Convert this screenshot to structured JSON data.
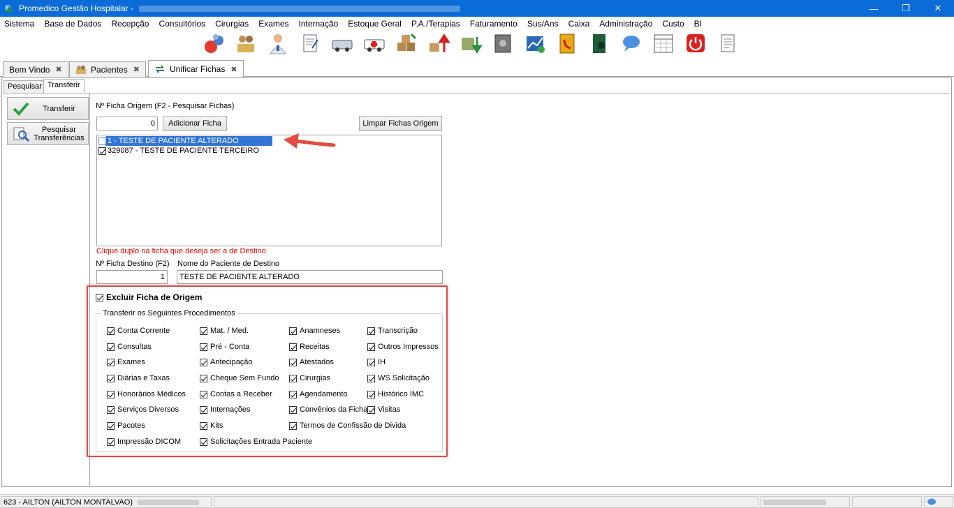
{
  "window": {
    "title": "Promedico Gestão Hospitalar - ",
    "controls": {
      "minimize": "—",
      "maximize": "❐",
      "close": "✕"
    }
  },
  "menu": [
    "Sistema",
    "Base de Dados",
    "Recepção",
    "Consultórios",
    "Cirurgias",
    "Exames",
    "Internação",
    "Estoque Geral",
    "P.A./Terapias",
    "Faturamento",
    "Sus/Ans",
    "Caixa",
    "Administração",
    "Custo",
    "BI"
  ],
  "toolbar_icons": [
    "users-refresh-icon",
    "reception-icon",
    "doctor-icon",
    "prescription-icon",
    "ambulance-icon",
    "emergency-icon",
    "stock-boxes-icon",
    "stock-up-icon",
    "money-icon",
    "safe-icon",
    "billing-chart-icon",
    "phone-book-icon",
    "book-icon",
    "chat-icon",
    "calendar-icon",
    "power-icon",
    "notes-icon"
  ],
  "doc_tabs": [
    {
      "label": "Bem Vindo",
      "close": "✖"
    },
    {
      "label": "Pacientes",
      "close": "✖"
    },
    {
      "label": "Unificar Fichas",
      "close": "✖"
    }
  ],
  "sub_tabs": [
    "Pesquisar",
    "Transferir"
  ],
  "side_buttons": {
    "transferir": "Transferir",
    "pesquisar_line1": "Pesquisar",
    "pesquisar_line2": "Transferências"
  },
  "origem": {
    "label": "Nº Ficha Origem (F2 - Pesquisar Fichas)",
    "value": "0",
    "add_button": "Adicionar Ficha",
    "clear_button": "Limpar Fichas Origem",
    "list": [
      {
        "text": "1 - TESTE DE PACIENTE ALTERADO",
        "checked": false,
        "selected": true
      },
      {
        "text": "329087 - TESTE DE PACIENTE TERCEIRO",
        "checked": true,
        "selected": false
      }
    ]
  },
  "hint": "Clique duplo na ficha que deseja ser a de Destino",
  "destino": {
    "ficha_label": "Nº Ficha Destino (F2)",
    "nome_label": "Nome do Paciente de Destino",
    "ficha_value": "1",
    "nome_value": "TESTE DE PACIENTE ALTERADO"
  },
  "excluir_label": "Excluir Ficha de Origem",
  "group_title": "Transferir os Seguintes Procedimentos",
  "procedures": {
    "col1": [
      "Conta Corrente",
      "Consultas",
      "Exames",
      "Diárias e Taxas",
      "Honorários Médicos",
      "Serviços Diversos",
      "Pacotes",
      "Impressão DICOM"
    ],
    "col2": [
      "Mat. / Med.",
      "Pré - Conta",
      "Antecipação",
      "Cheque Sem Fundo",
      "Contas a Receber",
      "Internações",
      "Kits",
      "Solicitações Entrada Paciente"
    ],
    "col3": [
      "Anamneses",
      "Receitas",
      "Atestados",
      "Cirurgias",
      "Agendamento",
      "Convênios da Ficha",
      "Termos de Confissão de Divida"
    ],
    "col4": [
      "Transcrição",
      "Outros Impressos",
      "IH",
      "WS Solicitação",
      "Histórico IMC",
      "Visitas"
    ]
  },
  "statusbar": {
    "user": "623 - AILTON (AILTON MONTALVAO)"
  },
  "colors": {
    "titlebar": "#0b6cd8",
    "selection": "#3375d6",
    "hint": "#e00000",
    "highlight": "#e04a4a"
  }
}
